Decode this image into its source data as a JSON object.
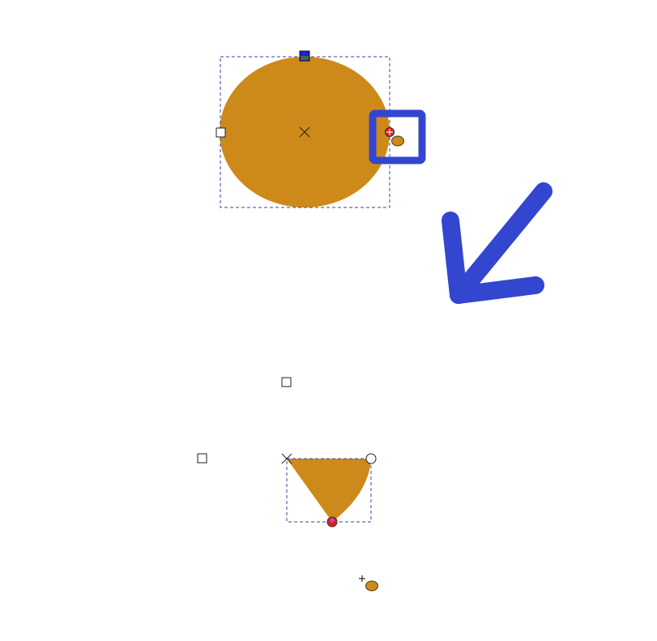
{
  "canvas": {
    "background": "#ffffff"
  },
  "colors": {
    "shape_fill": "#CD8A1A",
    "selection_dash": "#3f3f9f",
    "handle_fill": "#ffffff",
    "handle_stroke": "#222222",
    "rotation_handle": "#1f1fd0",
    "node_handle": "#e81c1c",
    "annotation_blue": "#3346d0"
  },
  "icons": {
    "center_marker": "x-cross-icon",
    "resize_handle": "square-handle-icon",
    "rotate_handle": "square-handle-blue-icon",
    "arc_handle": "circle-node-icon",
    "cursor": "crosshair-cursor-icon",
    "tool": "ellipse-tool-icon",
    "annotation_arrow": "arrow-down-left-icon",
    "annotation_box": "highlight-box-icon"
  },
  "ellipse_before": {
    "name": "ellipse-shape",
    "state": "full-ellipse"
  },
  "ellipse_after": {
    "name": "pie-slice-shape",
    "state": "pie-segment"
  }
}
